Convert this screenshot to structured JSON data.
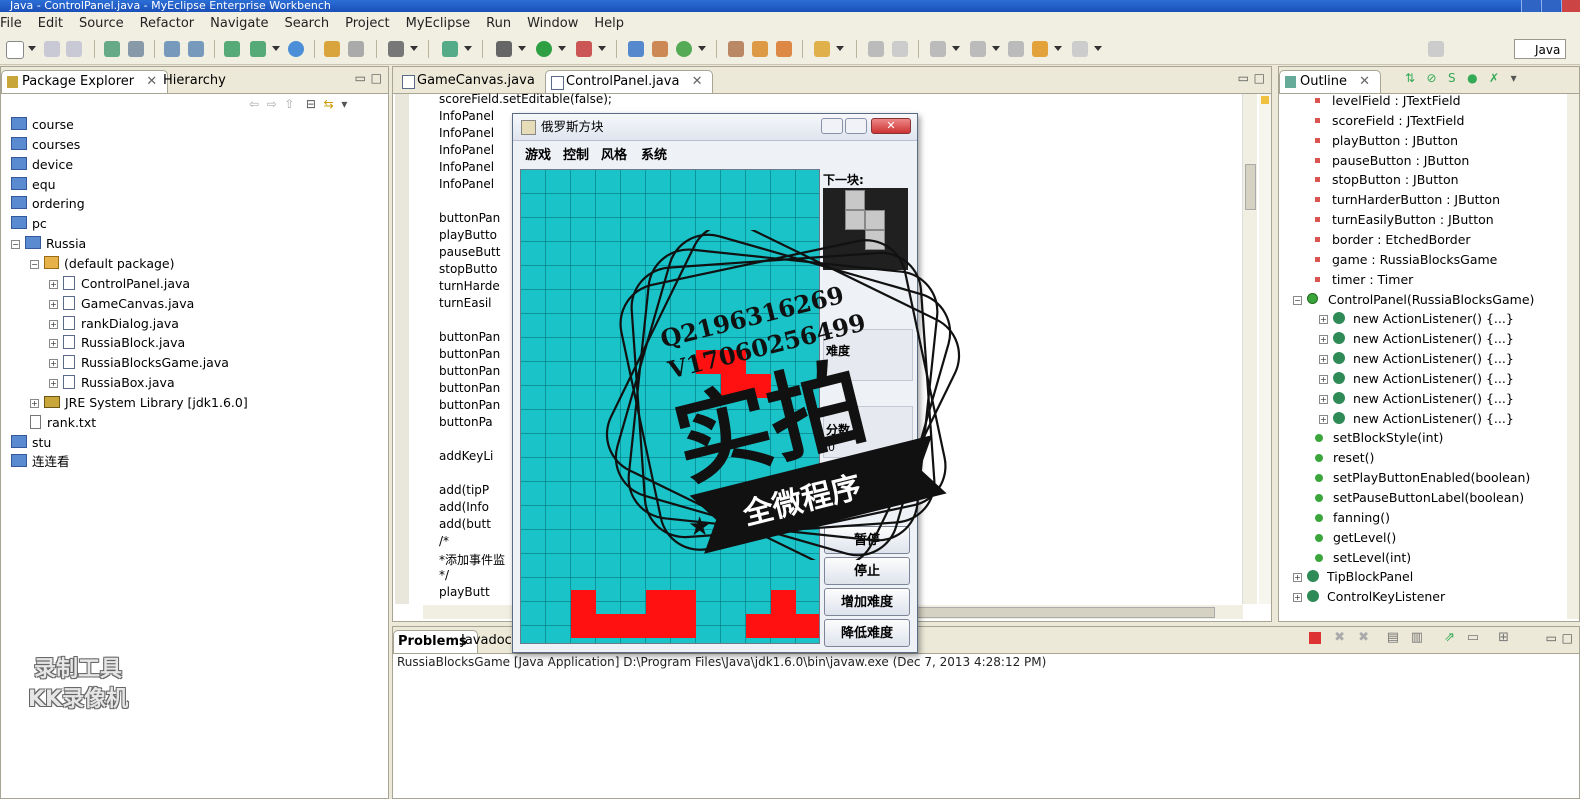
{
  "window_title": "Java - ControlPanel.java - MyEclipse Enterprise Workbench",
  "menu": [
    "File",
    "Edit",
    "Source",
    "Refactor",
    "Navigate",
    "Search",
    "Project",
    "MyEclipse",
    "Run",
    "Window",
    "Help"
  ],
  "perspective": "Java",
  "left_tabs": {
    "active": "Package Explorer",
    "other": "Hierarchy"
  },
  "tree": [
    {
      "label": "course",
      "type": "folder",
      "indent": 0
    },
    {
      "label": "courses",
      "type": "folder",
      "indent": 0
    },
    {
      "label": "device",
      "type": "folder",
      "indent": 0
    },
    {
      "label": "equ",
      "type": "folder",
      "indent": 0
    },
    {
      "label": "ordering",
      "type": "folder",
      "indent": 0
    },
    {
      "label": "pc",
      "type": "folder",
      "indent": 0
    },
    {
      "label": "Russia",
      "type": "project",
      "indent": 0
    },
    {
      "label": "(default package)",
      "type": "package",
      "indent": 1
    },
    {
      "label": "ControlPanel.java",
      "type": "java",
      "indent": 2
    },
    {
      "label": "GameCanvas.java",
      "type": "java",
      "indent": 2
    },
    {
      "label": "rankDialog.java",
      "type": "java",
      "indent": 2
    },
    {
      "label": "RussiaBlock.java",
      "type": "java",
      "indent": 2
    },
    {
      "label": "RussiaBlocksGame.java",
      "type": "java",
      "indent": 2
    },
    {
      "label": "RussiaBox.java",
      "type": "java",
      "indent": 2
    },
    {
      "label": "JRE System Library [jdk1.6.0]",
      "type": "lib",
      "indent": 1
    },
    {
      "label": "rank.txt",
      "type": "txt",
      "indent": 1
    },
    {
      "label": "stu",
      "type": "folder",
      "indent": 0
    },
    {
      "label": "连连看",
      "type": "folder",
      "indent": 0
    }
  ],
  "editor_tabs": [
    "GameCanvas.java",
    "ControlPanel.java"
  ],
  "code_lines": [
    "scoreField.setEditable(false);",
    "InfoPanel",
    "InfoPanel",
    "InfoPanel",
    "InfoPanel",
    "InfoPanel",
    "",
    "buttonPan",
    "playButto",
    "pauseButt",
    "stopButto",
    "turnHarde",
    "turnEasil",
    "",
    "buttonPan",
    "buttonPan",
    "buttonPan",
    "buttonPan",
    "buttonPan",
    " buttonPa",
    "",
    " addKeyLi",
    "",
    " add(tipP",
    " add(Info",
    " add(butt",
    "/*",
    "*添加事件监",
    " */",
    " playButt"
  ],
  "outline_title": "Outline",
  "outline": [
    {
      "label": "levelField : JTextField",
      "icon": "field-final",
      "indent": 1
    },
    {
      "label": "scoreField : JTextField",
      "icon": "field-final",
      "indent": 1
    },
    {
      "label": "playButton : JButton",
      "icon": "field",
      "indent": 1
    },
    {
      "label": "pauseButton : JButton",
      "icon": "field",
      "indent": 1
    },
    {
      "label": "stopButton : JButton",
      "icon": "field",
      "indent": 1
    },
    {
      "label": "turnHarderButton : JButton",
      "icon": "field",
      "indent": 1
    },
    {
      "label": "turnEasilyButton : JButton",
      "icon": "field",
      "indent": 1
    },
    {
      "label": "border : EtchedBorder",
      "icon": "field",
      "indent": 1
    },
    {
      "label": "game : RussiaBlocksGame",
      "icon": "field",
      "indent": 1
    },
    {
      "label": "timer : Timer",
      "icon": "field",
      "indent": 1
    },
    {
      "label": "ControlPanel(RussiaBlocksGame)",
      "icon": "constructor",
      "indent": 1
    },
    {
      "label": "new ActionListener() {...}",
      "icon": "anon",
      "indent": 2
    },
    {
      "label": "new ActionListener() {...}",
      "icon": "anon",
      "indent": 2
    },
    {
      "label": "new ActionListener() {...}",
      "icon": "anon",
      "indent": 2
    },
    {
      "label": "new ActionListener() {...}",
      "icon": "anon",
      "indent": 2
    },
    {
      "label": "new ActionListener() {...}",
      "icon": "anon",
      "indent": 2
    },
    {
      "label": "new ActionListener() {...}",
      "icon": "anon",
      "indent": 2
    },
    {
      "label": "setBlockStyle(int)",
      "icon": "method",
      "indent": 1
    },
    {
      "label": "reset()",
      "icon": "method",
      "indent": 1
    },
    {
      "label": "setPlayButtonEnabled(boolean)",
      "icon": "method",
      "indent": 1
    },
    {
      "label": "setPauseButtonLabel(boolean)",
      "icon": "method",
      "indent": 1
    },
    {
      "label": "fanning()",
      "icon": "method",
      "indent": 1
    },
    {
      "label": "getLevel()",
      "icon": "method",
      "indent": 1
    },
    {
      "label": "setLevel(int)",
      "icon": "method",
      "indent": 1
    },
    {
      "label": "TipBlockPanel",
      "icon": "class",
      "indent": 1
    },
    {
      "label": "ControlKeyListener",
      "icon": "class",
      "indent": 1
    }
  ],
  "bottom_tabs": {
    "active": "Problems",
    "other": "Javadoc"
  },
  "console_line": "RussiaBlocksGame [Java Application] D:\\Program Files\\Java\\jdk1.6.0\\bin\\javaw.exe (Dec 7, 2013 4:28:12 PM)",
  "game": {
    "title": "俄罗斯方块",
    "menu": [
      "游戏",
      "控制",
      "风格",
      "系统"
    ],
    "next_label": "下一块:",
    "level_label": "难度",
    "score_label": "分数",
    "score_value": "0",
    "buttons": {
      "pause": "暂停",
      "stop": "停止",
      "harder": "增加难度",
      "easier": "降低难度"
    },
    "board_color": "#19c3c7",
    "block_color": "#ff1111"
  },
  "stamp": {
    "line1": "Q2196316269",
    "line2": "V17060256499",
    "big": "实拍",
    "banner": "全微程序"
  },
  "watermark": {
    "line1": "录制工具",
    "line2": "KK录像机"
  }
}
